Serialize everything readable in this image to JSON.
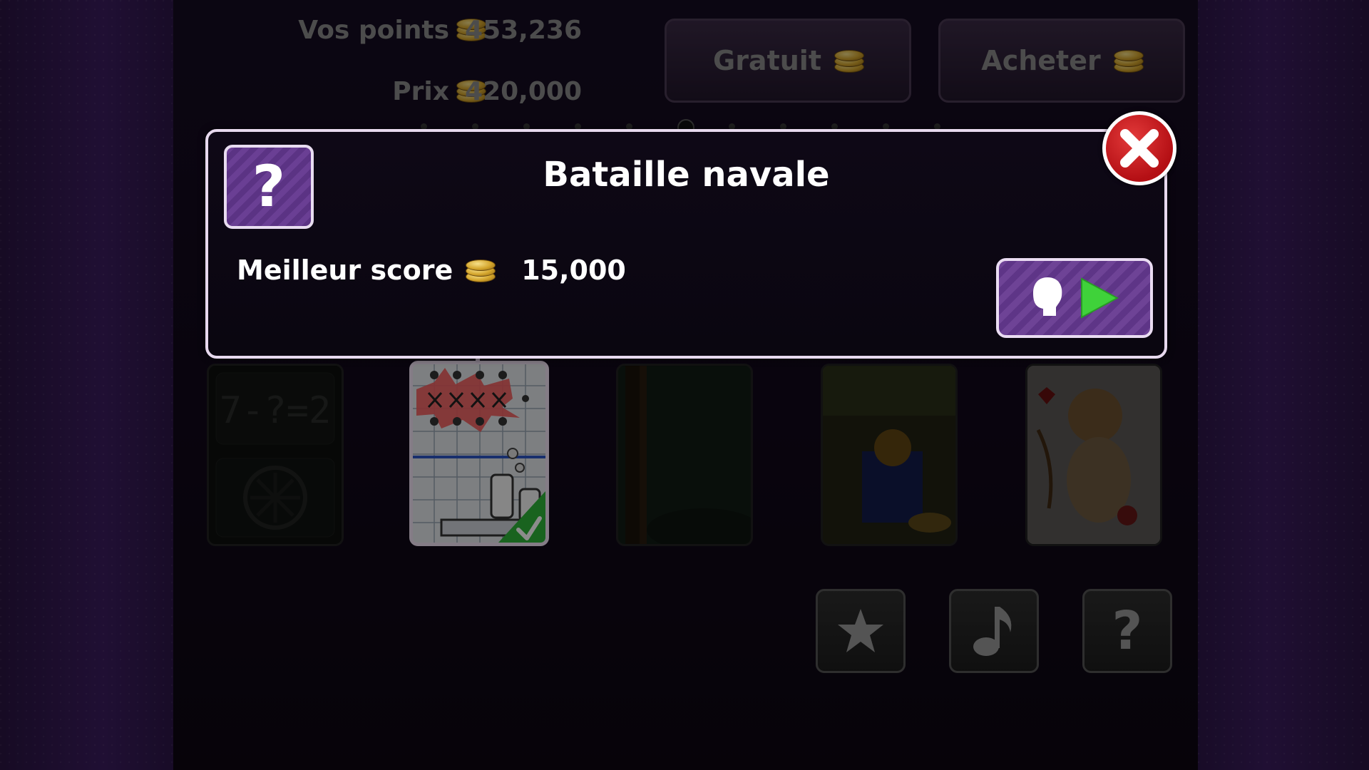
{
  "stats": {
    "points_label": "Vos points",
    "points_value": "453,236",
    "price_label": "Prix",
    "price_value": "420,000"
  },
  "top_buttons": {
    "free_label": "Gratuit",
    "buy_label": "Acheter"
  },
  "pager": {
    "count": 11,
    "active_index": 5
  },
  "modal": {
    "title": "Bataille navale",
    "best_score_label": "Meilleur score",
    "best_score_value": "15,000",
    "icons": [
      "question-icon",
      "coin-icon",
      "player-head-icon",
      "play-icon",
      "close-icon"
    ]
  },
  "games": [
    {
      "name": "math-puzzle-thumbnail",
      "selected": false
    },
    {
      "name": "battleship-thumbnail",
      "selected": true
    },
    {
      "name": "forest-thumbnail",
      "selected": false
    },
    {
      "name": "gift-box-thumbnail",
      "selected": false
    },
    {
      "name": "cupid-thumbnail",
      "selected": false
    }
  ],
  "bottom_buttons": [
    "star-icon",
    "music-note-icon",
    "help-icon"
  ],
  "colors": {
    "accent_purple": "#6a3f94",
    "close_red": "#c4161c",
    "play_green": "#3fd23a",
    "coin_gold": "#d4a52c"
  }
}
